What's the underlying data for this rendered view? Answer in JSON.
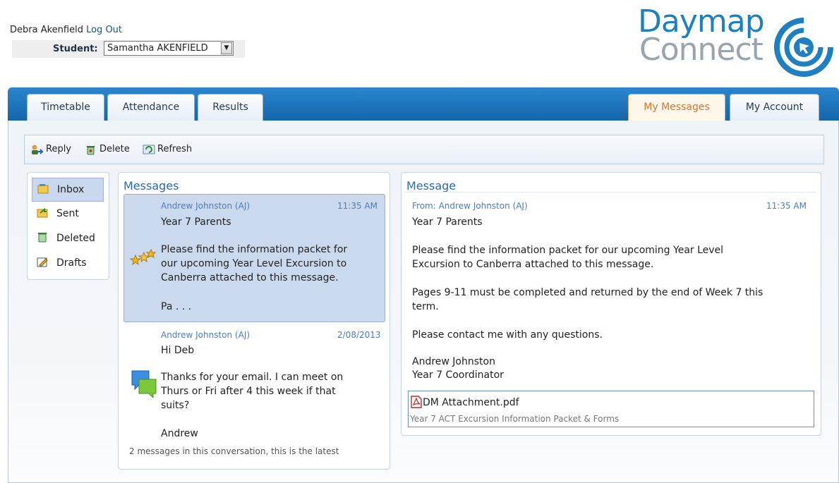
{
  "header": {
    "user_name": "Debra Akenfield",
    "logout_label": "Log Out",
    "student_label": "Student:",
    "student_value": "Samantha AKENFIELD"
  },
  "logo": {
    "line1": "Daymap",
    "line2": "Connect"
  },
  "tabs": {
    "timetable": "Timetable",
    "attendance": "Attendance",
    "results": "Results",
    "my_messages": "My Messages",
    "my_account": "My Account"
  },
  "toolbar": {
    "reply": "Reply",
    "delete": "Delete",
    "refresh": "Refresh"
  },
  "folders": {
    "inbox": "Inbox",
    "sent": "Sent",
    "deleted": "Deleted",
    "drafts": "Drafts"
  },
  "messages_panel": {
    "title": "Messages",
    "items": [
      {
        "from": "Andrew Johnston (AJ)",
        "time": "11:35 AM",
        "subject": "Year 7 Parents",
        "body_lines": [
          "Please find the information packet for",
          "our upcoming Year Level Excursion to",
          "Canberra attached to this message."
        ],
        "preview_end": "Pa . . ."
      },
      {
        "from": "Andrew Johnston (AJ)",
        "time": "2/08/2013",
        "subject": "Hi Deb",
        "body_lines": [
          "Thanks for your email. I can meet on",
          "Thurs or Fri after 4 this week if that",
          "suits?"
        ],
        "signoff": "Andrew",
        "conversation_note": "2 messages in this conversation, this is the latest"
      }
    ]
  },
  "message_detail": {
    "title": "Message",
    "from": "From: Andrew Johnston (AJ)",
    "time": "11:35 AM",
    "subject": "Year 7 Parents",
    "para1_line1": "Please find the information packet for our upcoming Year Level",
    "para1_line2": "Excursion to Canberra attached to this message.",
    "para2_line1": "Pages 9-11 must be completed and returned by the end of Week 7 this",
    "para2_line2": "term.",
    "para3": "Please contact me with any questions.",
    "sig_name": "Andrew Johnston",
    "sig_title": "Year 7 Coordinator",
    "attachment_name": "DM Attachment.pdf",
    "attachment_desc": "Year 7 ACT Excursion Information Packet & Forms"
  },
  "colors": {
    "accent_blue": "#1e7fc1",
    "tab_active": "#d8752a",
    "link": "#1a4f9c"
  }
}
